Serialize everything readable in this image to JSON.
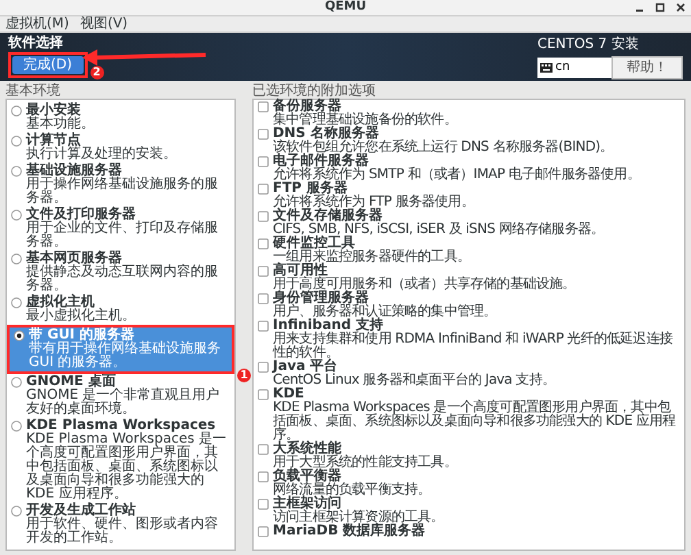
{
  "window": {
    "title": "QEMU"
  },
  "menu": [
    "虚拟机(M)",
    "视图(V)"
  ],
  "header": {
    "title": "软件选择",
    "done_button": "完成(D)",
    "product": "CENTOS 7 安装",
    "keyboard": "cn",
    "help_button": "帮助！"
  },
  "base_environment": {
    "heading": "基本环境",
    "items": [
      {
        "name": "最小安装",
        "description": "基本功能。",
        "selected": false
      },
      {
        "name": "计算节点",
        "description": "执行计算及处理的安装。",
        "selected": false
      },
      {
        "name": "基础设施服务器",
        "description": "用于操作网络基础设施服务的服务器。",
        "selected": false
      },
      {
        "name": "文件及打印服务器",
        "description": "用于企业的文件、打印及存储服务器。",
        "selected": false
      },
      {
        "name": "基本网页服务器",
        "description": "提供静态及动态互联网内容的服务器。",
        "selected": false
      },
      {
        "name": "虚拟化主机",
        "description": "最小虚拟化主机。",
        "selected": false
      },
      {
        "name": "带 GUI 的服务器",
        "description": "带有用于操作网络基础设施服务 GUI 的服务器。",
        "selected": true
      },
      {
        "name": "GNOME 桌面",
        "description": "GNOME 是一个非常直观且用户友好的桌面环境。",
        "selected": false
      },
      {
        "name": "KDE Plasma Workspaces",
        "description": "KDE Plasma Workspaces 是一个高度可配置图形用户界面，其中包括面板、桌面、系统图标以及桌面向导和很多功能强大的 KDE 应用程序。",
        "selected": false
      },
      {
        "name": "开发及生成工作站",
        "description": "用于软件、硬件、图形或者内容开发的工作站。",
        "selected": false
      }
    ]
  },
  "addons": {
    "heading": "已选环境的附加选项",
    "items": [
      {
        "name": "备份服务器",
        "description": "集中管理基础设施备份的软件。",
        "checked": false
      },
      {
        "name": "DNS 名称服务器",
        "description": "该软件包组允许您在系统上运行 DNS 名称服务器(BIND)。",
        "checked": false
      },
      {
        "name": "电子邮件服务器",
        "description": "允许将系统作为 SMTP 和（或者）IMAP 电子邮件服务器使用。",
        "checked": false
      },
      {
        "name": "FTP 服务器",
        "description": "允许将系统作为 FTP 服务器使用。",
        "checked": false
      },
      {
        "name": "文件及存储服务器",
        "description": "CIFS, SMB, NFS, iSCSI, iSER 及 iSNS 网络存储服务器。",
        "checked": false
      },
      {
        "name": "硬件监控工具",
        "description": "一组用来监控服务器硬件的工具。",
        "checked": false
      },
      {
        "name": "高可用性",
        "description": "用于高度可用服务和（或者）共享存储的基础设施。",
        "checked": false
      },
      {
        "name": "身份管理服务器",
        "description": "用户、服务器和认证策略的集中管理。",
        "checked": false
      },
      {
        "name": "Infiniband 支持",
        "description": "用来支持集群和使用 RDMA InfiniBand 和 iWARP 光纤的低延迟连接性的软件。",
        "checked": false
      },
      {
        "name": "Java 平台",
        "description": "CentOS Linux 服务器和桌面平台的 Java 支持。",
        "checked": false
      },
      {
        "name": "KDE",
        "description": "KDE Plasma Workspaces 是一个高度可配置图形用户界面，其中包括面板、桌面、系统图标以及桌面向导和很多功能强大的 KDE 应用程序。",
        "checked": false
      },
      {
        "name": "大系统性能",
        "description": "用于大型系统的性能支持工具。",
        "checked": false
      },
      {
        "name": "负载平衡器",
        "description": "网络流量的负载平衡支持。",
        "checked": false
      },
      {
        "name": "主框架访问",
        "description": "访问主框架计算资源的工具。",
        "checked": false
      },
      {
        "name": "MariaDB 数据库服务器",
        "checked": false
      }
    ]
  },
  "annotations": [
    {
      "label": "1"
    },
    {
      "label": "2"
    }
  ]
}
